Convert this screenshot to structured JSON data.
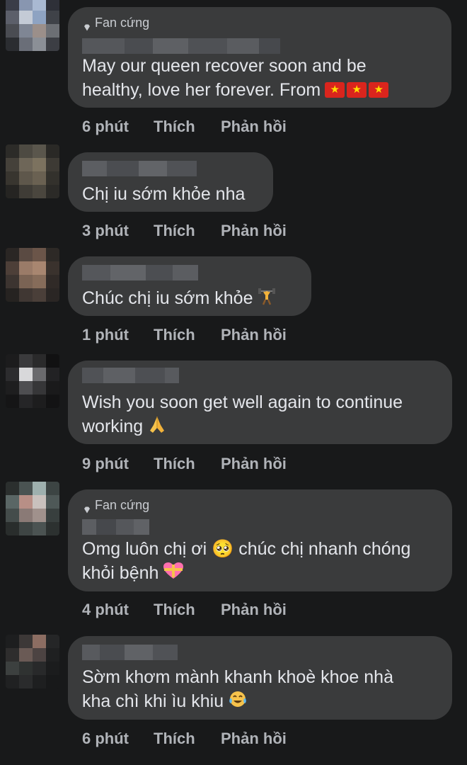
{
  "comments": [
    {
      "badge": "Fan cứng",
      "text_lines": [
        "May our queen recover soon and be",
        "healthy, love her forever. From"
      ],
      "emoji": "vn-flags",
      "time": "6 phút",
      "like": "Thích",
      "reply": "Phản hồi"
    },
    {
      "badge": "",
      "text_lines": [
        "Chị iu sớm khỏe nha"
      ],
      "emoji": "",
      "time": "3 phút",
      "like": "Thích",
      "reply": "Phản hồi"
    },
    {
      "badge": "",
      "text_lines": [
        "Chúc chị iu sớm khỏe"
      ],
      "emoji": "weightlifter",
      "time": "1 phút",
      "like": "Thích",
      "reply": "Phản hồi"
    },
    {
      "badge": "",
      "text_lines": [
        "Wish you soon get well again to continue",
        "working"
      ],
      "emoji": "folded-hands",
      "time": "9 phút",
      "like": "Thích",
      "reply": "Phản hồi"
    },
    {
      "badge": "Fan cứng",
      "text_lines": [
        "Omg luôn chị ơi 🥺 chúc chị nhanh chóng",
        "khỏi bệnh"
      ],
      "emoji": "heart-ribbon",
      "time": "4 phút",
      "like": "Thích",
      "reply": "Phản hồi"
    },
    {
      "badge": "",
      "text_lines": [
        "Sờm khơm mành khanh khoè khoe nhà",
        "kha chì khi ìu khiu"
      ],
      "emoji": "tears-of-joy",
      "time": "6 phút",
      "like": "Thích",
      "reply": "Phản hồi"
    }
  ],
  "colors": {
    "background": "#18191a",
    "bubble": "#3a3b3c",
    "text": "#e4e6eb",
    "meta": "#b0b3b8"
  }
}
